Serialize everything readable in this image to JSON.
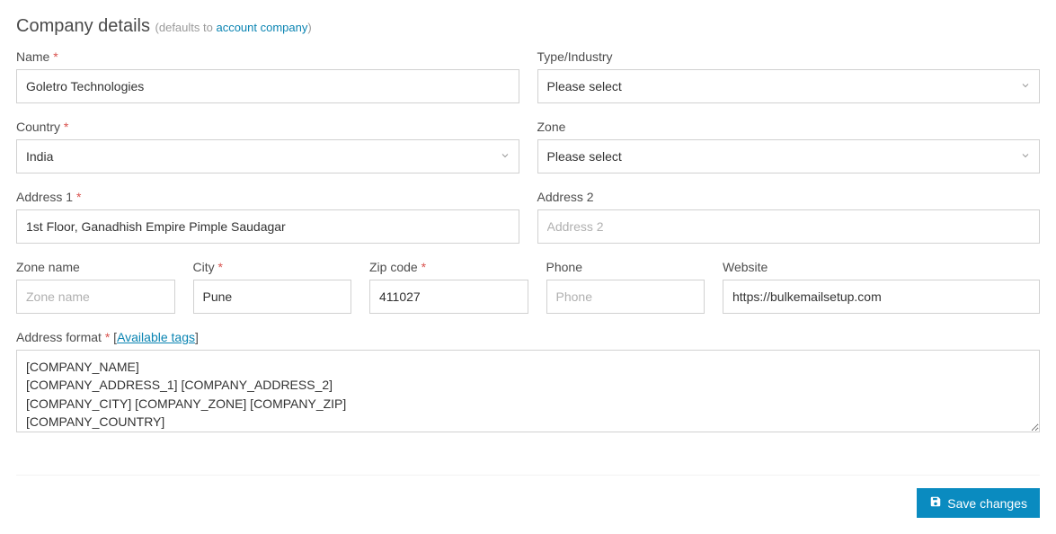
{
  "header": {
    "title": "Company details",
    "defaults_prefix": "(defaults to ",
    "defaults_link": "account company",
    "defaults_suffix": ")"
  },
  "fields": {
    "name": {
      "label": "Name",
      "value": "Goletro Technologies"
    },
    "type_industry": {
      "label": "Type/Industry",
      "selected": "Please select"
    },
    "country": {
      "label": "Country",
      "selected": "India"
    },
    "zone": {
      "label": "Zone",
      "selected": "Please select"
    },
    "address1": {
      "label": "Address 1",
      "value": "1st Floor, Ganadhish Empire Pimple Saudagar"
    },
    "address2": {
      "label": "Address 2",
      "placeholder": "Address 2",
      "value": ""
    },
    "zone_name": {
      "label": "Zone name",
      "placeholder": "Zone name",
      "value": ""
    },
    "city": {
      "label": "City",
      "value": "Pune"
    },
    "zip": {
      "label": "Zip code",
      "value": "411027"
    },
    "phone": {
      "label": "Phone",
      "placeholder": "Phone",
      "value": ""
    },
    "website": {
      "label": "Website",
      "value": "https://bulkemailsetup.com"
    },
    "address_format": {
      "label": "Address format",
      "link_label": "Available tags",
      "value": "[COMPANY_NAME]\n[COMPANY_ADDRESS_1] [COMPANY_ADDRESS_2]\n[COMPANY_CITY] [COMPANY_ZONE] [COMPANY_ZIP]\n[COMPANY_COUNTRY]"
    }
  },
  "actions": {
    "save": "Save changes"
  }
}
